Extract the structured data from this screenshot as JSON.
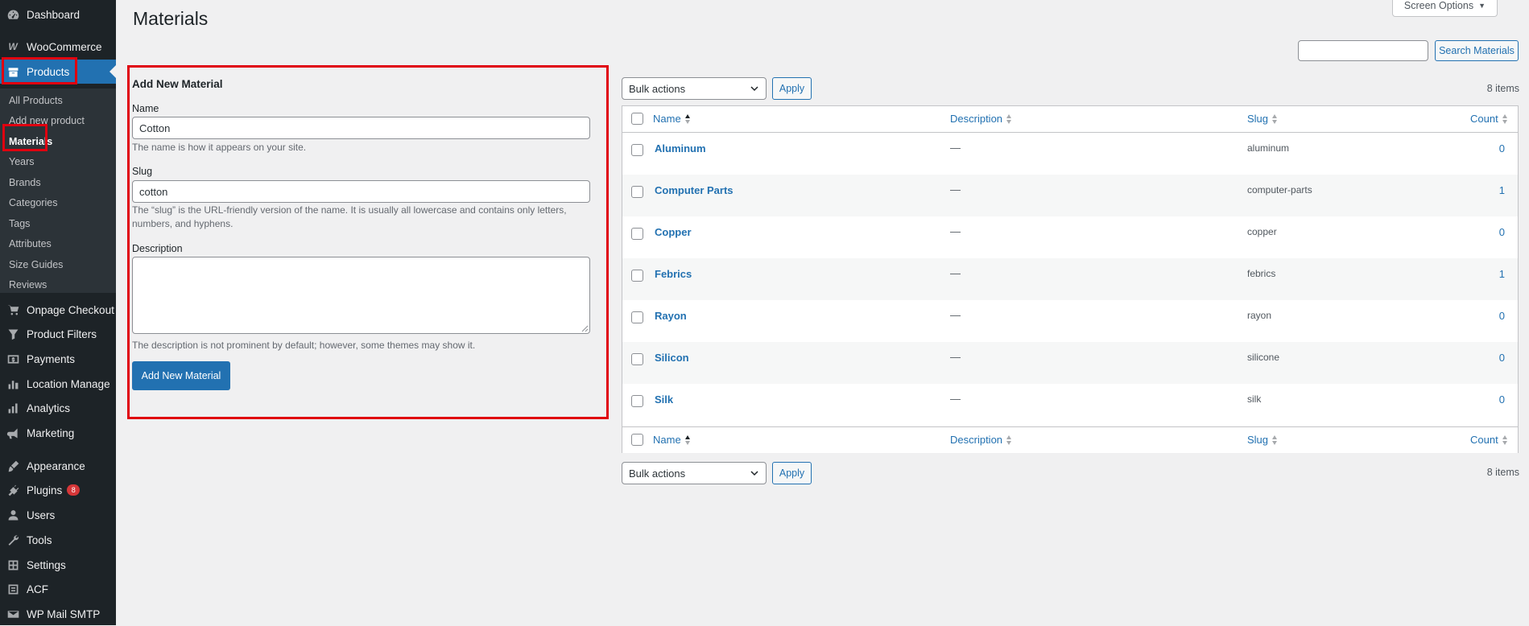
{
  "sidebar": {
    "menu": [
      {
        "label": "Dashboard",
        "icon": "dashboard-icon"
      },
      {
        "label": "WooCommerce",
        "icon": "woocommerce-icon"
      },
      {
        "label": "Products",
        "icon": "products-icon"
      },
      {
        "label": "Onpage Checkout",
        "icon": "cart-icon"
      },
      {
        "label": "Product Filters",
        "icon": "filter-icon"
      },
      {
        "label": "Payments",
        "icon": "payments-icon"
      },
      {
        "label": "Location Manage",
        "icon": "location-icon"
      },
      {
        "label": "Analytics",
        "icon": "analytics-icon"
      },
      {
        "label": "Marketing",
        "icon": "marketing-icon"
      },
      {
        "label": "Appearance",
        "icon": "appearance-icon"
      },
      {
        "label": "Plugins",
        "icon": "plugins-icon",
        "badge": "8"
      },
      {
        "label": "Users",
        "icon": "users-icon"
      },
      {
        "label": "Tools",
        "icon": "tools-icon"
      },
      {
        "label": "Settings",
        "icon": "settings-icon"
      },
      {
        "label": "ACF",
        "icon": "acf-icon"
      },
      {
        "label": "WP Mail SMTP",
        "icon": "mail-icon"
      }
    ],
    "submenu": [
      "All Products",
      "Add new product",
      "Materials",
      "Years",
      "Brands",
      "Categories",
      "Tags",
      "Attributes",
      "Size Guides",
      "Reviews"
    ],
    "current_sub": "Materials"
  },
  "header": {
    "title": "Materials",
    "screen_options": "Screen Options",
    "search_button": "Search Materials",
    "search_value": ""
  },
  "form": {
    "title": "Add New Material",
    "name_label": "Name",
    "name_value": "Cotton",
    "name_help": "The name is how it appears on your site.",
    "slug_label": "Slug",
    "slug_value": "cotton",
    "slug_help": "The “slug” is the URL-friendly version of the name. It is usually all lowercase and contains only letters, numbers, and hyphens.",
    "description_label": "Description",
    "description_value": "",
    "description_help": "The description is not prominent by default; however, some themes may show it.",
    "submit_label": "Add New Material"
  },
  "table": {
    "bulk_actions": "Bulk actions",
    "apply": "Apply",
    "items_count": "8 items",
    "columns": {
      "name": "Name",
      "description": "Description",
      "slug": "Slug",
      "count": "Count"
    },
    "rows": [
      {
        "name": "Aluminum",
        "description": "—",
        "slug": "aluminum",
        "count": "0"
      },
      {
        "name": "Computer Parts",
        "description": "—",
        "slug": "computer-parts",
        "count": "1"
      },
      {
        "name": "Copper",
        "description": "—",
        "slug": "copper",
        "count": "0"
      },
      {
        "name": "Febrics",
        "description": "—",
        "slug": "febrics",
        "count": "1"
      },
      {
        "name": "Rayon",
        "description": "—",
        "slug": "rayon",
        "count": "0"
      },
      {
        "name": "Silicon",
        "description": "—",
        "slug": "silicone",
        "count": "0"
      },
      {
        "name": "Silk",
        "description": "—",
        "slug": "silk",
        "count": "0"
      }
    ]
  },
  "colors": {
    "sidebar_bg": "#1d2327",
    "submenu_bg": "#2c3338",
    "accent": "#2271b1",
    "highlight_box": "#e0000f",
    "badge": "#d63638"
  }
}
